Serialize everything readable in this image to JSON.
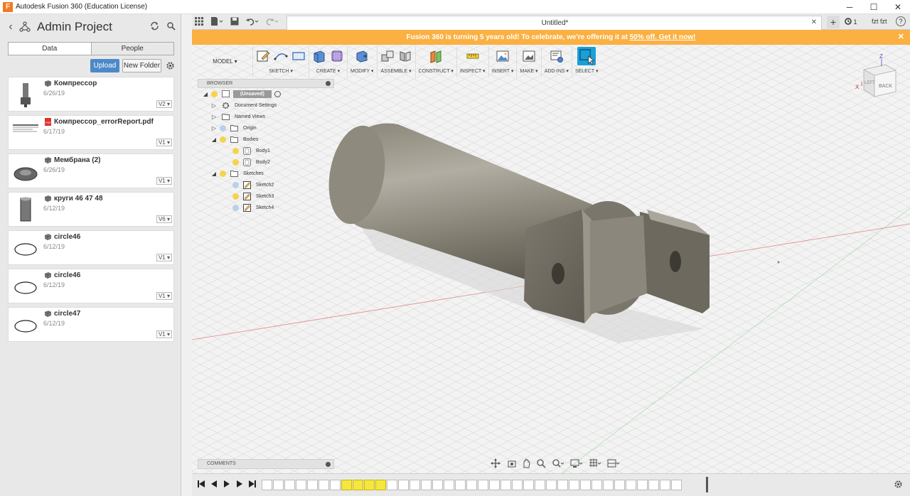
{
  "window": {
    "title": "Autodesk Fusion 360 (Education License)",
    "app_icon_letter": "F",
    "minimize": "─",
    "maximize": "☐",
    "close": "✕"
  },
  "data_panel": {
    "back": "‹",
    "project_title": "Admin Project",
    "tabs": {
      "data": "Data",
      "people": "People"
    },
    "upload_label": "Upload",
    "new_folder_label": "New Folder",
    "files": [
      {
        "name": "Компрессор",
        "date": "6/26/19",
        "version": "V2 ▾",
        "type": "design"
      },
      {
        "name": "Компрессор_errorReport.pdf",
        "date": "6/17/19",
        "version": "V1 ▾",
        "type": "pdf"
      },
      {
        "name": "Мембрана (2)",
        "date": "6/26/19",
        "version": "V1 ▾",
        "type": "design"
      },
      {
        "name": "круги 46 47 48",
        "date": "6/12/19",
        "version": "V6 ▾",
        "type": "design"
      },
      {
        "name": "circle46",
        "date": "6/12/19",
        "version": "V1 ▾",
        "type": "design"
      },
      {
        "name": "circle46",
        "date": "6/12/19",
        "version": "V1 ▾",
        "type": "design"
      },
      {
        "name": "circle47",
        "date": "6/12/19",
        "version": "V1 ▾",
        "type": "design"
      }
    ]
  },
  "tab_bar": {
    "document_tab": "Untitled*",
    "close": "✕",
    "add": "+",
    "jobs_count": "1",
    "user": "fzt fzt",
    "help": "?"
  },
  "banner": {
    "text": "Fusion 360 is turning 5 years old! To celebrate, we're offering it at ",
    "link": "50% off. Get it now!",
    "close": "✕"
  },
  "toolbar": {
    "mode": "MODEL ▾",
    "groups": [
      "SKETCH ▾",
      "CREATE ▾",
      "MODIFY ▾",
      "ASSEMBLE ▾",
      "CONSTRUCT ▾",
      "INSPECT ▾",
      "INSERT ▾",
      "MAKE ▾",
      "ADD-INS ▾",
      "SELECT ▾"
    ]
  },
  "browser": {
    "title": "BROWSER",
    "root": "(Unsaved)",
    "items": [
      {
        "label": "Document Settings",
        "level": 1
      },
      {
        "label": "Named Views",
        "level": 1
      },
      {
        "label": "Origin",
        "level": 1
      },
      {
        "label": "Bodies",
        "level": 1
      },
      {
        "label": "Body1",
        "level": 2
      },
      {
        "label": "Body2",
        "level": 2
      },
      {
        "label": "Sketches",
        "level": 1
      },
      {
        "label": "Sketch2",
        "level": 2
      },
      {
        "label": "Sketch3",
        "level": 2
      },
      {
        "label": "Sketch4",
        "level": 2
      }
    ]
  },
  "comments": {
    "title": "COMMENTS"
  },
  "viewcube": {
    "back": "BACK",
    "left": "LEFT",
    "z": "Z",
    "x": "X"
  },
  "colors": {
    "banner": "#fbb042",
    "accent": "#4c89c9",
    "select_active": "#1a9fd6",
    "highlight": "#f5e642"
  }
}
